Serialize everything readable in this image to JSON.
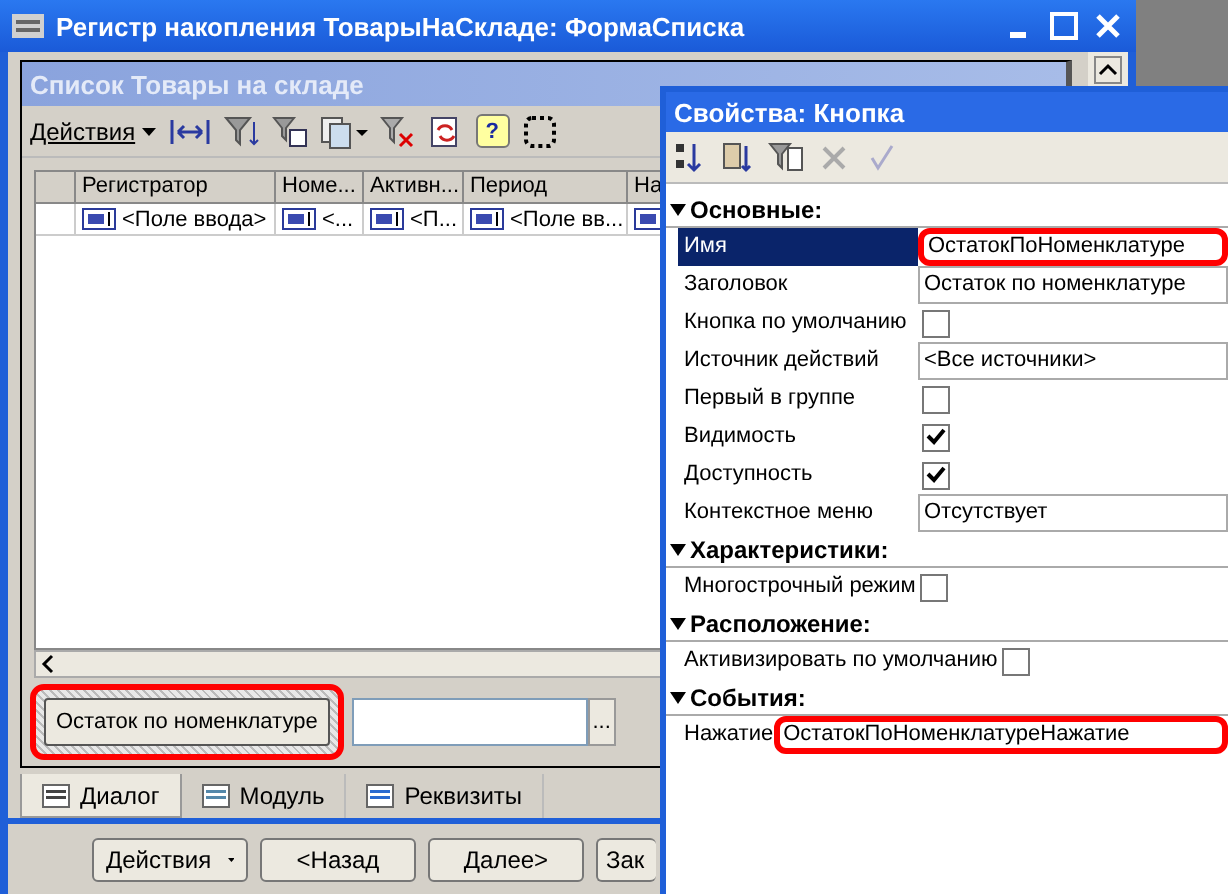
{
  "window": {
    "title": "Регистр накопления ТоварыНаСкладе: ФормаСписка"
  },
  "list_form": {
    "title": "Список Товары на складе",
    "actions_menu": "Действия",
    "help": "?",
    "columns": [
      "Регистратор",
      "Номе...",
      "Активн...",
      "Период",
      "На"
    ],
    "row": [
      "<Поле ввода>",
      "<...",
      "<П...",
      "<Поле вв..."
    ],
    "button": {
      "label": "Остаток по номенклатуре",
      "highlighted": true
    },
    "field_button": "..."
  },
  "tabs": [
    {
      "label": "Диалог",
      "selected": true
    },
    {
      "label": "Модуль",
      "selected": false
    },
    {
      "label": "Реквизиты",
      "selected": false
    }
  ],
  "bottom_buttons": [
    {
      "label": "Действия",
      "menu": true
    },
    {
      "label": "<Назад",
      "menu": false
    },
    {
      "label": "Далее>",
      "menu": false
    },
    {
      "label": "Зак",
      "menu": false
    }
  ],
  "properties": {
    "title": "Свойства: Кнопка",
    "sections": [
      {
        "title": "Основные:",
        "expanded": true,
        "rows": [
          {
            "kind": "text",
            "label": "Имя",
            "value": "ОстатокПоНоменклатуре",
            "selected": true,
            "highlighted": true
          },
          {
            "kind": "text",
            "label": "Заголовок",
            "value": "Остаток по номенклатуре",
            "selected": false,
            "highlighted": false
          },
          {
            "kind": "checkbox",
            "label": "Кнопка по умолчанию",
            "checked": false,
            "selected": false
          },
          {
            "kind": "text",
            "label": "Источник действий",
            "value": "<Все источники>",
            "selected": false,
            "highlighted": false
          },
          {
            "kind": "checkbox",
            "label": "Первый в группе",
            "checked": false,
            "selected": false
          },
          {
            "kind": "checkbox",
            "label": "Видимость",
            "checked": true,
            "selected": false
          },
          {
            "kind": "checkbox",
            "label": "Доступность",
            "checked": true,
            "selected": false
          },
          {
            "kind": "text",
            "label": "Контекстное меню",
            "value": "Отсутствует",
            "selected": false,
            "highlighted": false
          }
        ]
      },
      {
        "title": "Характеристики:",
        "expanded": true,
        "rows": [
          {
            "kind": "inline-checkbox",
            "label": "Многострочный режим",
            "checked": false,
            "selected": false
          }
        ]
      },
      {
        "title": "Расположение:",
        "expanded": true,
        "rows": [
          {
            "kind": "inline-checkbox",
            "label": "Активизировать по умолчанию",
            "checked": false,
            "selected": false
          }
        ]
      },
      {
        "title": "События:",
        "expanded": true,
        "rows": [
          {
            "kind": "event",
            "label": "Нажатие",
            "value": "ОстатокПоНоменклатуреНажатие",
            "selected": false,
            "highlighted": true
          }
        ]
      }
    ]
  }
}
